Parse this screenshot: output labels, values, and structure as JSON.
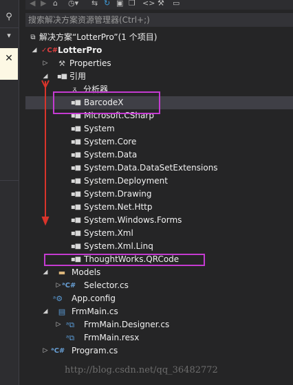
{
  "search": {
    "placeholder": "搜索解决方案资源管理器(Ctrl+;)"
  },
  "toolbar": {
    "icons": [
      "back-icon",
      "forward-icon",
      "home-icon",
      "history-icon",
      "sync-icon",
      "refresh-icon",
      "collapse-icon",
      "copy-icon",
      "code-icon",
      "wrench-icon",
      "preview-icon"
    ]
  },
  "left_panel": {
    "close_glyph": "✕"
  },
  "tree": {
    "solution": "解决方案“LotterPro”(1 个项目)",
    "project": "LotterPro",
    "properties": "Properties",
    "references": "引用",
    "analyzers": "分析器",
    "refs": [
      "BarcodeX",
      "Microsoft.CSharp",
      "System",
      "System.Core",
      "System.Data",
      "System.Data.DataSetExtensions",
      "System.Deployment",
      "System.Drawing",
      "System.Net.Http",
      "System.Windows.Forms",
      "System.Xml",
      "System.Xml.Linq",
      "ThoughtWorks.QRCode"
    ],
    "models": "Models",
    "selector": "Selector.cs",
    "app_config": "App.config",
    "frmmain": "FrmMain.cs",
    "frmmain_designer": "FrmMain.Designer.cs",
    "frmmain_resx": "FrmMain.resx",
    "program": "Program.cs"
  },
  "watermark": "http://blog.csdn.net/qq_36482772",
  "colors": {
    "highlight_box": "#c53bd2",
    "arrow": "#d9342b",
    "selected_row": "#3f3f46"
  }
}
